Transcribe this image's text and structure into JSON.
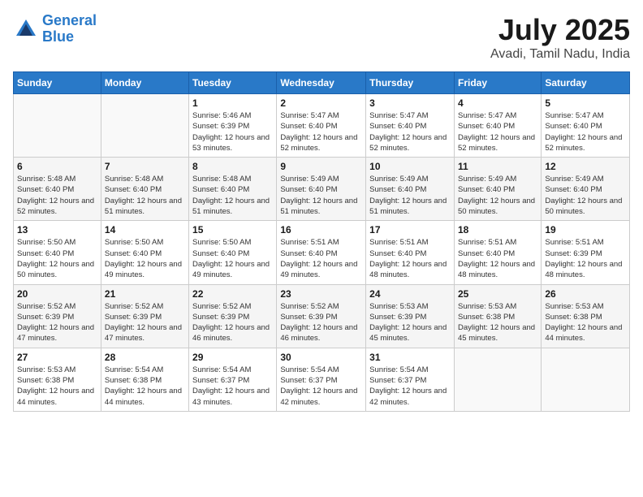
{
  "header": {
    "logo_line1": "General",
    "logo_line2": "Blue",
    "title": "July 2025",
    "subtitle": "Avadi, Tamil Nadu, India"
  },
  "weekdays": [
    "Sunday",
    "Monday",
    "Tuesday",
    "Wednesday",
    "Thursday",
    "Friday",
    "Saturday"
  ],
  "weeks": [
    [
      {
        "day": "",
        "info": ""
      },
      {
        "day": "",
        "info": ""
      },
      {
        "day": "1",
        "info": "Sunrise: 5:46 AM\nSunset: 6:39 PM\nDaylight: 12 hours and 53 minutes."
      },
      {
        "day": "2",
        "info": "Sunrise: 5:47 AM\nSunset: 6:40 PM\nDaylight: 12 hours and 52 minutes."
      },
      {
        "day": "3",
        "info": "Sunrise: 5:47 AM\nSunset: 6:40 PM\nDaylight: 12 hours and 52 minutes."
      },
      {
        "day": "4",
        "info": "Sunrise: 5:47 AM\nSunset: 6:40 PM\nDaylight: 12 hours and 52 minutes."
      },
      {
        "day": "5",
        "info": "Sunrise: 5:47 AM\nSunset: 6:40 PM\nDaylight: 12 hours and 52 minutes."
      }
    ],
    [
      {
        "day": "6",
        "info": "Sunrise: 5:48 AM\nSunset: 6:40 PM\nDaylight: 12 hours and 52 minutes."
      },
      {
        "day": "7",
        "info": "Sunrise: 5:48 AM\nSunset: 6:40 PM\nDaylight: 12 hours and 51 minutes."
      },
      {
        "day": "8",
        "info": "Sunrise: 5:48 AM\nSunset: 6:40 PM\nDaylight: 12 hours and 51 minutes."
      },
      {
        "day": "9",
        "info": "Sunrise: 5:49 AM\nSunset: 6:40 PM\nDaylight: 12 hours and 51 minutes."
      },
      {
        "day": "10",
        "info": "Sunrise: 5:49 AM\nSunset: 6:40 PM\nDaylight: 12 hours and 51 minutes."
      },
      {
        "day": "11",
        "info": "Sunrise: 5:49 AM\nSunset: 6:40 PM\nDaylight: 12 hours and 50 minutes."
      },
      {
        "day": "12",
        "info": "Sunrise: 5:49 AM\nSunset: 6:40 PM\nDaylight: 12 hours and 50 minutes."
      }
    ],
    [
      {
        "day": "13",
        "info": "Sunrise: 5:50 AM\nSunset: 6:40 PM\nDaylight: 12 hours and 50 minutes."
      },
      {
        "day": "14",
        "info": "Sunrise: 5:50 AM\nSunset: 6:40 PM\nDaylight: 12 hours and 49 minutes."
      },
      {
        "day": "15",
        "info": "Sunrise: 5:50 AM\nSunset: 6:40 PM\nDaylight: 12 hours and 49 minutes."
      },
      {
        "day": "16",
        "info": "Sunrise: 5:51 AM\nSunset: 6:40 PM\nDaylight: 12 hours and 49 minutes."
      },
      {
        "day": "17",
        "info": "Sunrise: 5:51 AM\nSunset: 6:40 PM\nDaylight: 12 hours and 48 minutes."
      },
      {
        "day": "18",
        "info": "Sunrise: 5:51 AM\nSunset: 6:40 PM\nDaylight: 12 hours and 48 minutes."
      },
      {
        "day": "19",
        "info": "Sunrise: 5:51 AM\nSunset: 6:39 PM\nDaylight: 12 hours and 48 minutes."
      }
    ],
    [
      {
        "day": "20",
        "info": "Sunrise: 5:52 AM\nSunset: 6:39 PM\nDaylight: 12 hours and 47 minutes."
      },
      {
        "day": "21",
        "info": "Sunrise: 5:52 AM\nSunset: 6:39 PM\nDaylight: 12 hours and 47 minutes."
      },
      {
        "day": "22",
        "info": "Sunrise: 5:52 AM\nSunset: 6:39 PM\nDaylight: 12 hours and 46 minutes."
      },
      {
        "day": "23",
        "info": "Sunrise: 5:52 AM\nSunset: 6:39 PM\nDaylight: 12 hours and 46 minutes."
      },
      {
        "day": "24",
        "info": "Sunrise: 5:53 AM\nSunset: 6:39 PM\nDaylight: 12 hours and 45 minutes."
      },
      {
        "day": "25",
        "info": "Sunrise: 5:53 AM\nSunset: 6:38 PM\nDaylight: 12 hours and 45 minutes."
      },
      {
        "day": "26",
        "info": "Sunrise: 5:53 AM\nSunset: 6:38 PM\nDaylight: 12 hours and 44 minutes."
      }
    ],
    [
      {
        "day": "27",
        "info": "Sunrise: 5:53 AM\nSunset: 6:38 PM\nDaylight: 12 hours and 44 minutes."
      },
      {
        "day": "28",
        "info": "Sunrise: 5:54 AM\nSunset: 6:38 PM\nDaylight: 12 hours and 44 minutes."
      },
      {
        "day": "29",
        "info": "Sunrise: 5:54 AM\nSunset: 6:37 PM\nDaylight: 12 hours and 43 minutes."
      },
      {
        "day": "30",
        "info": "Sunrise: 5:54 AM\nSunset: 6:37 PM\nDaylight: 12 hours and 42 minutes."
      },
      {
        "day": "31",
        "info": "Sunrise: 5:54 AM\nSunset: 6:37 PM\nDaylight: 12 hours and 42 minutes."
      },
      {
        "day": "",
        "info": ""
      },
      {
        "day": "",
        "info": ""
      }
    ]
  ]
}
